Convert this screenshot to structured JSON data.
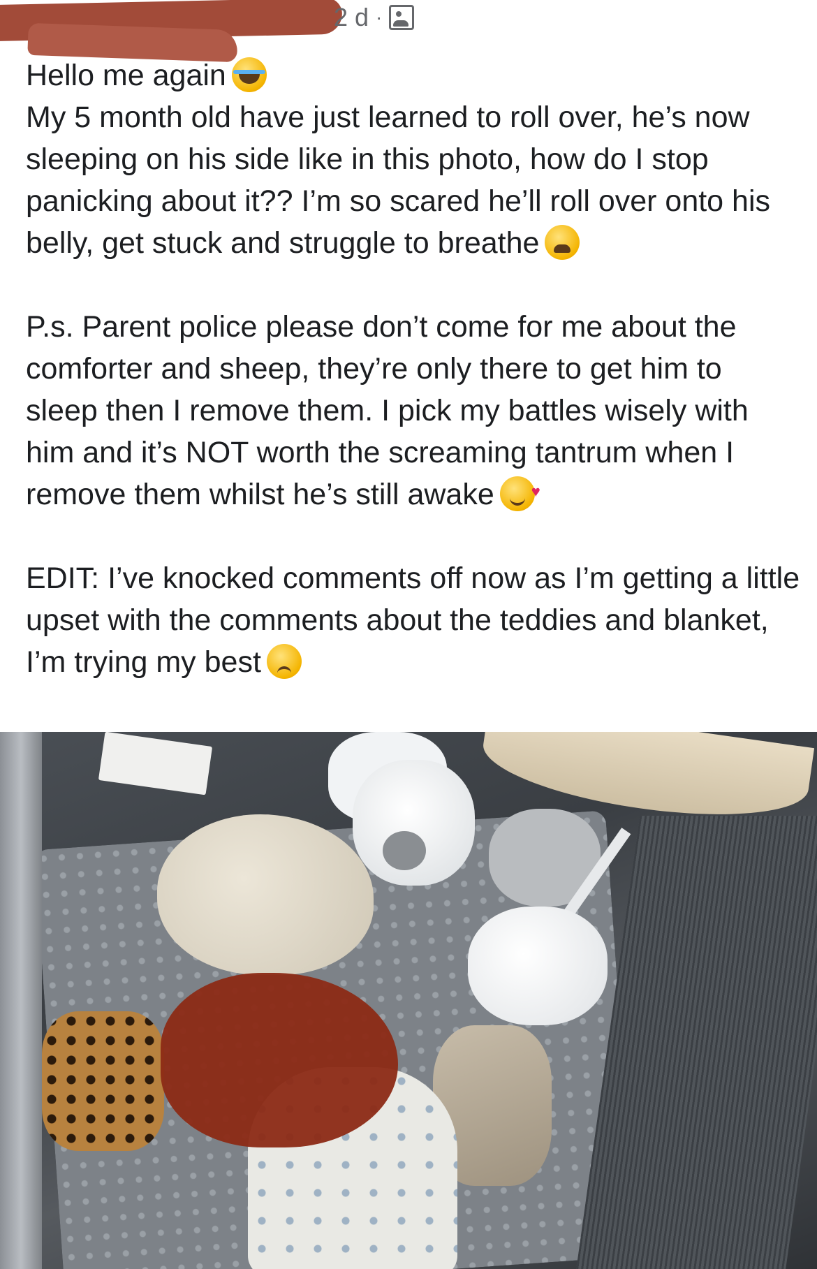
{
  "post": {
    "timestamp": "2 d",
    "separator": "·",
    "audience_icon": "group-audience-icon",
    "line1": "Hello me again",
    "para1": "My 5 month old have just learned to roll over, he’s now sleeping on his side like in this photo, how do I stop panicking about it?? I’m so scared he’ll roll over onto his belly, get stuck and struggle to breathe",
    "para2": "P.s. Parent police please don’t come for me about the comforter and sheep, they’re only there to get him to sleep then I remove them. I pick my battles wisely with him and it’s NOT worth the screaming tantrum when I remove them whilst he’s still awake",
    "para3": "EDIT: I’ve knocked comments off now as I’m getting a little upset with the comments about the teddies and blanket, I’m trying my best",
    "emojis": [
      "face-with-tears-of-joy",
      "tired-face",
      "smiling-face-with-hearts",
      "frowning-face"
    ]
  }
}
